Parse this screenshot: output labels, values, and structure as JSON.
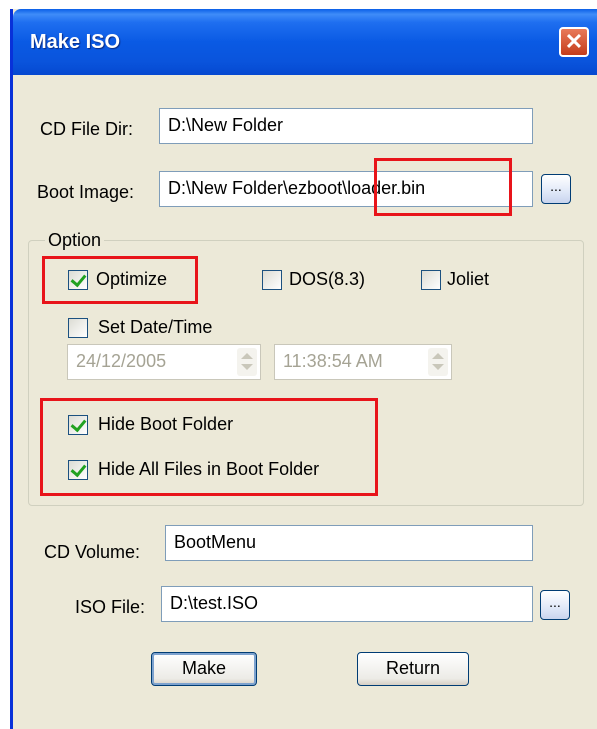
{
  "window": {
    "title": "Make ISO",
    "close_glyph": "✕"
  },
  "fields": {
    "cd_file_dir": {
      "label": "CD File Dir:",
      "value": "D:\\New Folder"
    },
    "boot_image": {
      "label": "Boot Image:",
      "value": "D:\\New Folder\\ezboot\\loader.bin",
      "browse": "..."
    },
    "cd_volume": {
      "label": "CD Volume:",
      "value": "BootMenu"
    },
    "iso_file": {
      "label": "ISO File:",
      "value": "D:\\test.ISO",
      "browse": "..."
    }
  },
  "option_group": {
    "label": "Option",
    "optimize": {
      "label": "Optimize",
      "checked": true
    },
    "dos83": {
      "label": "DOS(8.3)",
      "checked": false
    },
    "joliet": {
      "label": "Joliet",
      "checked": false
    },
    "set_date_time": {
      "label": "Set Date/Time",
      "checked": false
    },
    "date": "24/12/2005",
    "time": "11:38:54 AM",
    "hide_boot_folder": {
      "label": "Hide Boot Folder",
      "checked": true
    },
    "hide_all_files": {
      "label": "Hide All Files in Boot Folder",
      "checked": true
    }
  },
  "buttons": {
    "make": "Make",
    "return": "Return"
  },
  "colors": {
    "highlight": "#e8141a",
    "titlebar": "#0a5ae4",
    "check": "#21a121"
  }
}
